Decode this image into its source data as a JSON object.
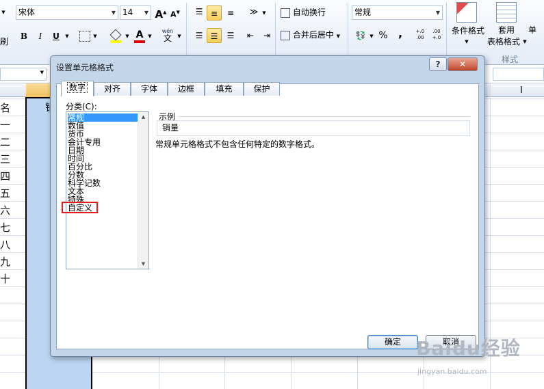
{
  "ribbon": {
    "font_name": "宋体",
    "font_size": "14",
    "grow_font": "A",
    "shrink_font": "A",
    "bold": "B",
    "italic": "I",
    "underline": "U",
    "font_color": "A",
    "phonetic": "wén",
    "phonetic_char": "文",
    "wrap_text": "自动换行",
    "merge_center": "合并后居中",
    "number_format": "常规",
    "percent": "%",
    "comma": ",",
    "inc_decimal": "+.0 .00",
    "dec_decimal": ".00 +.0",
    "conditional_format": "条件格式",
    "table_format_line1": "套用",
    "table_format_line2": "表格格式",
    "cell_styles": "单元",
    "styles_group": "样式",
    "left_cut_label": "刷"
  },
  "sheet": {
    "row_labels": [
      "名",
      "一",
      "二",
      "三",
      "四",
      "五",
      "六",
      "七",
      "八",
      "九",
      "十"
    ],
    "col_b_header_char": "销"
  },
  "dialog": {
    "title": "设置单元格格式",
    "help": "?",
    "close": "✕",
    "tabs": [
      "数字",
      "对齐",
      "字体",
      "边框",
      "填充",
      "保护"
    ],
    "category_label": "分类(C):",
    "categories": [
      "常规",
      "数值",
      "货币",
      "会计专用",
      "日期",
      "时间",
      "百分比",
      "分数",
      "科学记数",
      "文本",
      "特殊",
      "自定义"
    ],
    "selected_category": "常规",
    "sample_label": "示例",
    "sample_value": "销量",
    "description": "常规单元格格式不包含任何特定的数字格式。",
    "ok": "确定",
    "cancel": "取消"
  },
  "watermark": {
    "main": "Baidu经验",
    "sub": "jingyan.baidu.com"
  },
  "colors": {
    "selected_column": "#bcd6f2",
    "highlight_box": "#e31b1b",
    "list_selection": "#3399ff"
  }
}
